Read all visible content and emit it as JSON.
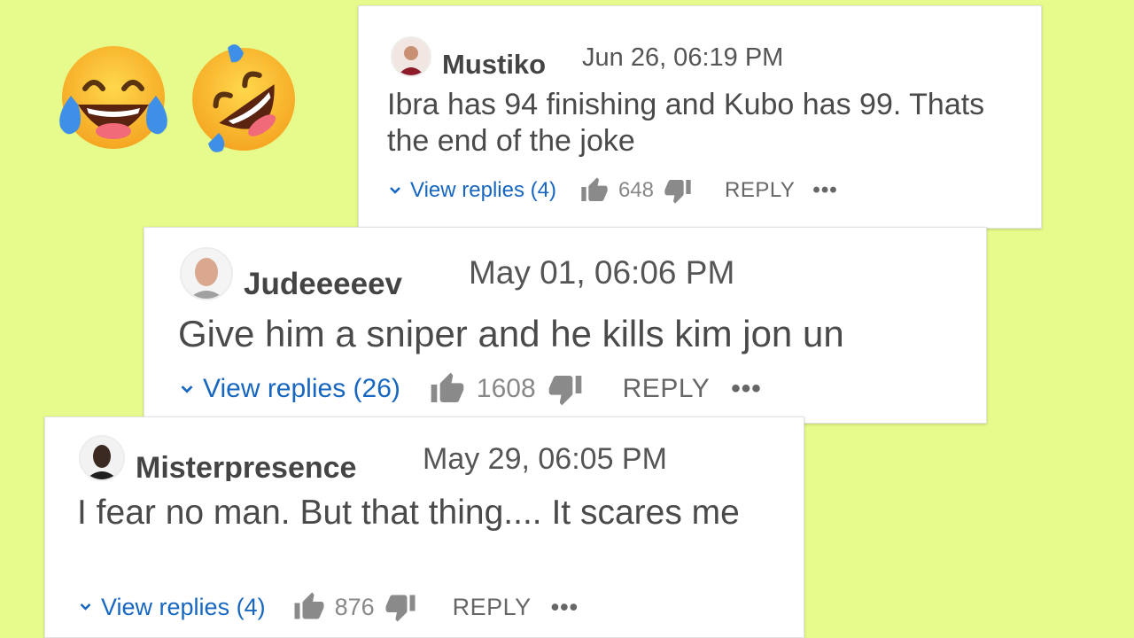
{
  "emojis": [
    {
      "name": "face-with-tears-of-joy",
      "glyph": "😂"
    },
    {
      "name": "rolling-on-floor-laughing",
      "glyph": "🤣"
    }
  ],
  "comments": [
    {
      "username": "Mustiko",
      "date": "Jun 26, 06:19 PM",
      "text": "Ibra has 94 finishing and Kubo has 99. Thats the end of the joke",
      "view_replies": "View replies (4)",
      "likes": "648",
      "reply_label": "REPLY",
      "more": "•••"
    },
    {
      "username": "Judeeeeev",
      "date": "May 01, 06:06 PM",
      "text": "Give him a sniper and he kills kim jon un",
      "view_replies": "View replies (26)",
      "likes": "1608",
      "reply_label": "REPLY",
      "more": "•••"
    },
    {
      "username": "Misterpresence",
      "date": "May 29, 06:05 PM",
      "text": "I fear no man. But that thing.... It scares me",
      "view_replies": "View replies (4)",
      "likes": "876",
      "reply_label": "REPLY",
      "more": "•••"
    }
  ],
  "colors": {
    "background": "#e6fb8b",
    "link": "#1766c0",
    "text": "#4a4a4a",
    "icon": "#8a8a8a"
  }
}
